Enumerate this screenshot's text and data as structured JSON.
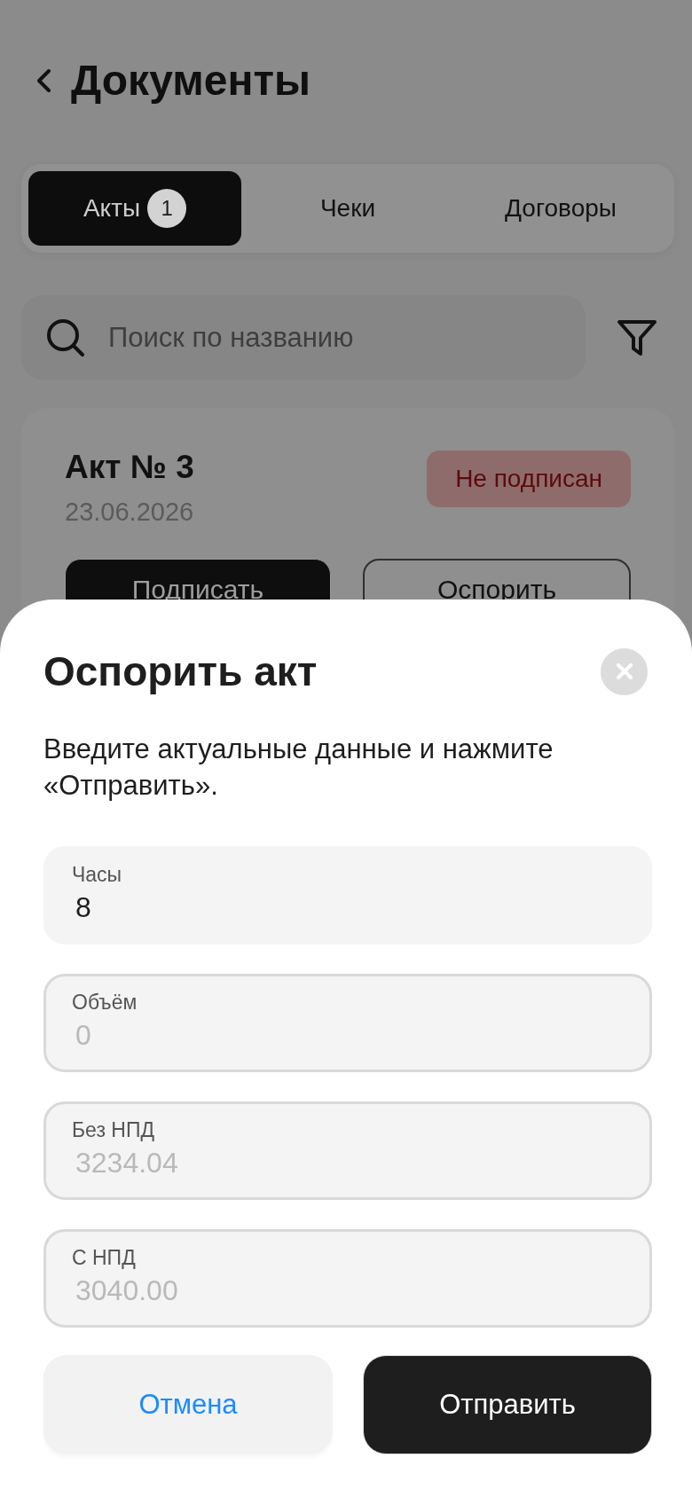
{
  "header": {
    "title": "Документы"
  },
  "tabs": [
    {
      "label": "Акты",
      "badge": "1",
      "selected": true
    },
    {
      "label": "Чеки",
      "selected": false
    },
    {
      "label": "Договоры",
      "selected": false
    }
  ],
  "search": {
    "placeholder": "Поиск по названию"
  },
  "documents": [
    {
      "title": "Акт № 3",
      "date": "23.06.2026",
      "status": "Не подписан",
      "actions": [
        {
          "label": "Подписать",
          "kind": "filled"
        },
        {
          "label": "Оспорить",
          "kind": "outlined"
        }
      ]
    }
  ],
  "dialog": {
    "title": "Оспорить акт",
    "description": "Введите актуальные данные и нажмите «Отправить».",
    "fields": [
      {
        "label": "Часы",
        "value": "8",
        "disabled": false
      },
      {
        "label": "Объём",
        "value": "0",
        "disabled": true
      },
      {
        "label": "Без НПД",
        "value": "3234.04",
        "disabled": true
      },
      {
        "label": "С НПД",
        "value": "3040.00",
        "disabled": true
      }
    ],
    "buttons": [
      {
        "label": "Отмена",
        "kind": "soft"
      },
      {
        "label": "Отправить",
        "kind": "filled"
      }
    ]
  }
}
